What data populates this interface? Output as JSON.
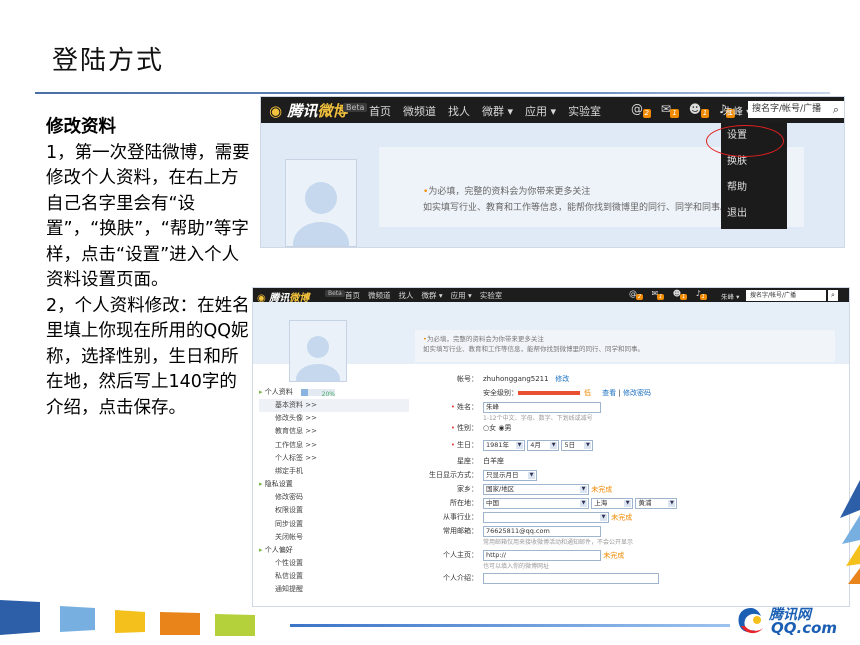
{
  "slide": {
    "title": "登陆方式",
    "text_head": "修改资料",
    "text_para1": "1，第一次登陆微博，需要修改个人资料，在右上方自己名字里会有“设置”，“换肤”，“帮助”等字样，点击“设置”进入个人资料设置页面。",
    "text_para2": "2，个人资料修改：在姓名里填上你现在所用的QQ妮称，选择性别，生日和所在地，然后写上140字的介绍，点击保存。"
  },
  "navbar": {
    "logo_a": "腾讯",
    "logo_b": "微博",
    "beta": "Beta",
    "nav_items": [
      "首页",
      "微频道",
      "找人",
      "微群 ▾",
      "应用 ▾",
      "实验室"
    ],
    "badges": [
      "2",
      "1",
      "1",
      "1"
    ],
    "user": "朱峰 ▾",
    "search_placeholder": "搜名字/帐号/广播",
    "icons": [
      "at-icon",
      "mail-icon",
      "user-icon",
      "sound-icon",
      "search-icon"
    ]
  },
  "shot1": {
    "notice_line1": "为必填，完整的资料会为你带来更多关注",
    "notice_line2": "如实填写行业、教育和工作等信息，能帮你找到微博里的同行、同学和同事。",
    "dropdown": [
      "设置",
      "换肤",
      "帮助",
      "退出"
    ]
  },
  "shot2": {
    "notice_line1": "为必填，完整的资料会为你带来更多关注",
    "notice_line2": "如实填写行业、教育和工作等信息，能帮你找到微博里的同行、同学和同事。",
    "sidebar": {
      "personal": "个人资料",
      "progress": "20%",
      "progress_value": 0.2,
      "personal_items": [
        "基本资料 >>",
        "修改头像 >>",
        "教育信息 >>",
        "工作信息 >>",
        "个人标签 >>",
        "绑定手机"
      ],
      "privacy": "隐私设置",
      "privacy_items": [
        "修改密码",
        "权限设置",
        "同步设置",
        "关闭帐号"
      ],
      "prefs": "个人偏好",
      "prefs_items": [
        "个性设置",
        "私信设置",
        "通知提醒"
      ]
    },
    "form": {
      "account_label": "帐号：",
      "account_value": "zhuhonggang5211",
      "account_edit": "修改",
      "security_label": "安全级别：",
      "security_level": "低",
      "security_view": "查看",
      "security_sep": "|",
      "security_change": "修改密码",
      "name_label": "姓名：",
      "name_value": "朱峰",
      "name_hint": "1-12个中文、字母、数字、下划线或减号",
      "gender_label": "性别：",
      "gender_female": "○女",
      "gender_male": "◉男",
      "birthday_label": "生日：",
      "birth_year": "1981年",
      "birth_month": "4月",
      "birth_day": "5日",
      "zodiac_label": "星座：",
      "zodiac_value": "白羊座",
      "birth_display_label": "生日显示方式：",
      "birth_display_value": "只显示月日",
      "hometown_label": "家乡：",
      "hometown_value": "国家/地区",
      "incomplete": "未完成",
      "location_label": "所在地：",
      "loc_country": "中国",
      "loc_province": "上海",
      "loc_district": "黄浦",
      "industry_label": "从事行业：",
      "email_label": "常用邮箱：",
      "email_value": "76625811@qq.com",
      "email_hint": "常用邮箱仅用来接收微博活动和通知邮件，不会公开显示",
      "homepage_label": "个人主页：",
      "homepage_value": "http://",
      "homepage_hint": "也可以填入你的微博网址",
      "intro_label": "个人介绍："
    }
  },
  "footer_logo": {
    "brand_cn": "腾讯网",
    "brand_url": "QQ.com"
  }
}
